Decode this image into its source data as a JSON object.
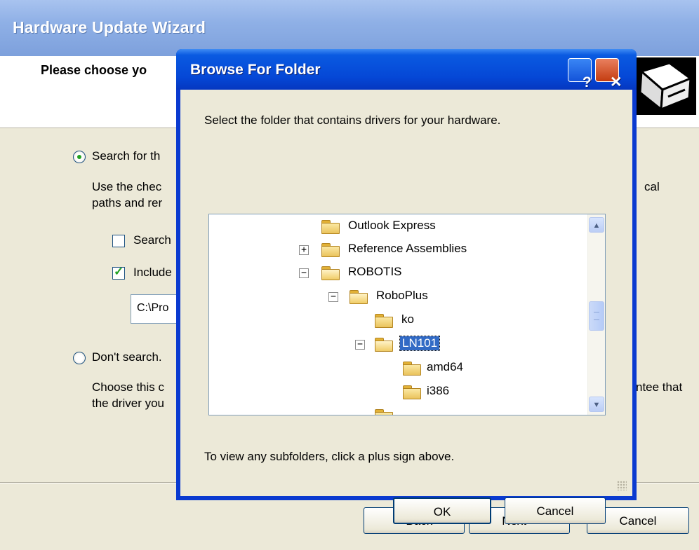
{
  "wizard": {
    "title": "Hardware Update Wizard",
    "header_title": "Please choose yo",
    "search_option": "Search for th",
    "search_desc_1": "Use the chec",
    "search_desc_2": "paths and rer",
    "search_desc_right": "cal",
    "search_removable": "Search",
    "include_location": "Include",
    "path_value": "C:\\Pro",
    "dont_search_option": "Don't search.",
    "dont_desc_1": "Choose this c",
    "dont_desc_2": "the driver you",
    "dont_desc_right": "ntee that",
    "back_button": "< Back",
    "next_button": "Next >",
    "cancel_button": "Cancel"
  },
  "dialog": {
    "title": "Browse For Folder",
    "help_button": "?",
    "close_button": "✕",
    "description": "Select the folder that contains drivers for your hardware.",
    "hint": "To view any subfolders, click a plus sign above.",
    "ok_button": "OK",
    "cancel_button": "Cancel",
    "tree": [
      {
        "label": "Outlook Express",
        "expander": "",
        "selected": false
      },
      {
        "label": "Reference Assemblies",
        "expander": "+",
        "selected": false
      },
      {
        "label": "ROBOTIS",
        "expander": "−",
        "selected": false
      },
      {
        "label": "RoboPlus",
        "expander": "−",
        "selected": false
      },
      {
        "label": "ko",
        "expander": "",
        "selected": false
      },
      {
        "label": "LN101",
        "expander": "−",
        "selected": true
      },
      {
        "label": "amd64",
        "expander": "",
        "selected": false
      },
      {
        "label": "i386",
        "expander": "",
        "selected": false
      }
    ],
    "scroll_up": "▲",
    "scroll_down": "▼"
  },
  "colors": {
    "dialog_title": "#0547d6",
    "wizard_title": "#8fb0e6",
    "selection": "#316ac5",
    "window_bg": "#ece9d8"
  }
}
